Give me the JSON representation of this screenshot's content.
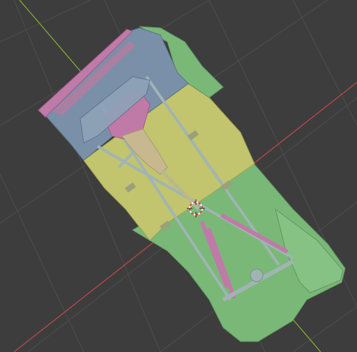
{
  "app": "3D viewport",
  "view": {
    "background_color": "#3d3d3d",
    "grid_color": "#4a4a4a",
    "x_axis_color": "#c8484f",
    "y_axis_color": "#8ab32f",
    "grid_visible": true
  },
  "model": {
    "colors": {
      "green_body": "#7ab878",
      "yellow_panel": "#c2c46e",
      "slate_blue": "#7a90a8",
      "pink_part": "#c07aa8",
      "tan_part": "#c8b890",
      "frame_gray": "#a0b4b4"
    }
  },
  "gizmo": {
    "icon": "3d-cursor-icon",
    "colors": [
      "#e04040",
      "#ffffff"
    ]
  }
}
